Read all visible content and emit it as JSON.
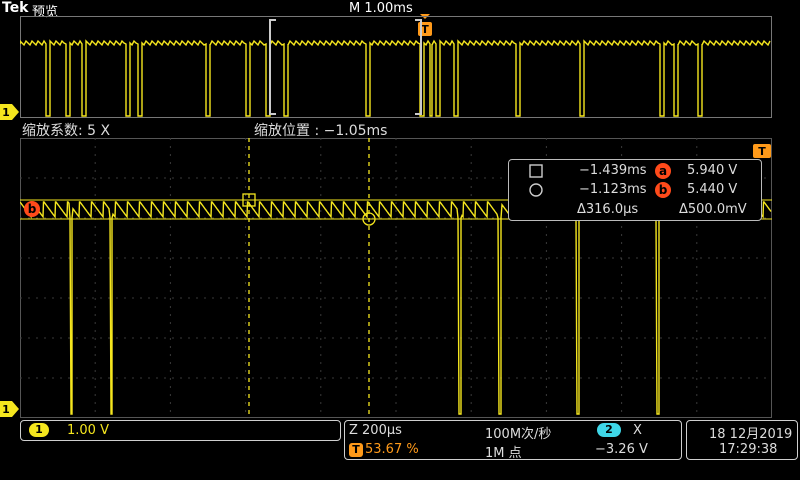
{
  "header": {
    "brand": "Tek",
    "mode": "预览",
    "timebase": "M 1.00ms",
    "trigger_marker": "T"
  },
  "zoom": {
    "factor_label": "缩放系数: 5 X",
    "position_label": "缩放位置 :  −1.05ms"
  },
  "markers": {
    "ch1_top": "1",
    "ch1_bottom": "1",
    "trigger_right": "T",
    "cursor_a": "a",
    "cursor_b": "b"
  },
  "cursor_readout": {
    "row1_time": "−1.439ms",
    "row1_letter": "a",
    "row1_volt": "5.940 V",
    "row2_time": "−1.123ms",
    "row2_letter": "b",
    "row2_volt": "5.440 V",
    "delta_time": "Δ316.0µs",
    "delta_volt": "Δ500.0mV"
  },
  "status_bar": {
    "ch1_badge": "1",
    "ch1_scale": "1.00 V",
    "zoom_time": "Z 200µs",
    "trigger_badge": "T",
    "trigger_percent": "53.67 %",
    "sample_rate": "100M次/秒",
    "record_length": "1M 点",
    "ch2_badge": "2",
    "ch2_symbol": "X",
    "ch2_level": "−3.26 V",
    "date": "18 12月2019",
    "time": "17:29:38"
  },
  "colors": {
    "ch1": "#f5e61e",
    "trigger": "#ff9a1a",
    "cursor_badge": "#ff4a1a",
    "ch2": "#3fd7e8"
  }
}
